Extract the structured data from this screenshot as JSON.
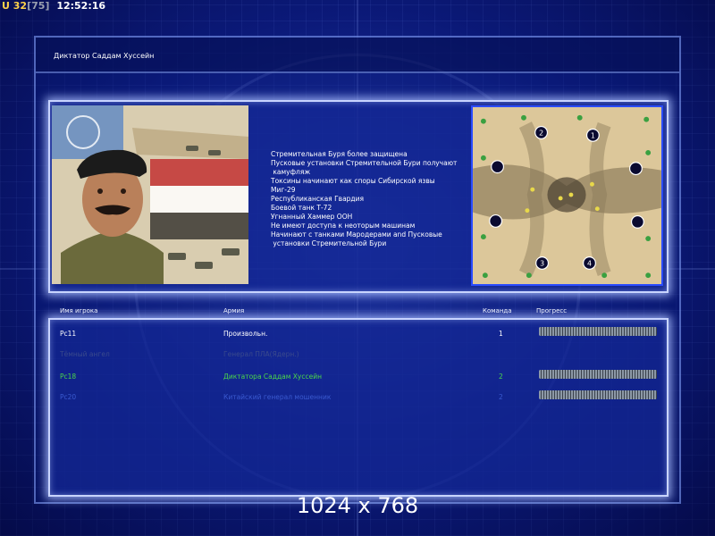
{
  "hud": {
    "unit_prefix": "U",
    "unit_count": "32",
    "unit_max": "[75]",
    "clock": "12:52:16"
  },
  "title": "Диктатор Саддам Хуссейн",
  "description": [
    "Стремительная Буря более защищена",
    "Пусковые установки Стремительной Бури получают",
    " камуфляж",
    "Токсины начинают как споры Сибирской язвы",
    "Миг-29",
    "Республиканская Гвардия",
    "Боевой танк Т-72",
    "Угнанный Хаммер ООН",
    "Не имеют доступа к неоторым машинам",
    "Начинают с танками Мародерами and Пусковые",
    " установки Стремительной Бури"
  ],
  "columns": {
    "player": "Имя игрока",
    "army": "Армия",
    "team": "Команда",
    "progress": "Прогресс"
  },
  "players": [
    {
      "name": "Pc11",
      "army": "Произвольн.",
      "team": "1",
      "progress": 1.0,
      "has_progress": true,
      "color": "#ffffff"
    },
    {
      "name": "Тёмный ангел",
      "army": "Генерал ПЛА(Ядерн.)",
      "team": "",
      "progress": null,
      "has_progress": false,
      "color": "#3a4a8c"
    },
    {
      "name": "Pc18",
      "army": "Диктатора Саддам Хуссейн",
      "team": "2",
      "progress": 1.0,
      "has_progress": true,
      "color": "#4ad64a"
    },
    {
      "name": "Pc20",
      "army": "Китайский генерал мошенник",
      "team": "2",
      "progress": 1.0,
      "has_progress": true,
      "color": "#3a5ad0"
    }
  ],
  "minimap": {
    "start_positions": [
      "2",
      "1",
      "3",
      "4"
    ]
  },
  "resolution_label": "1024 x 768",
  "colors": {
    "background": "#0b1a7a",
    "panel_glow": "#c8d4ff",
    "minimap_border": "#2a4cff"
  }
}
